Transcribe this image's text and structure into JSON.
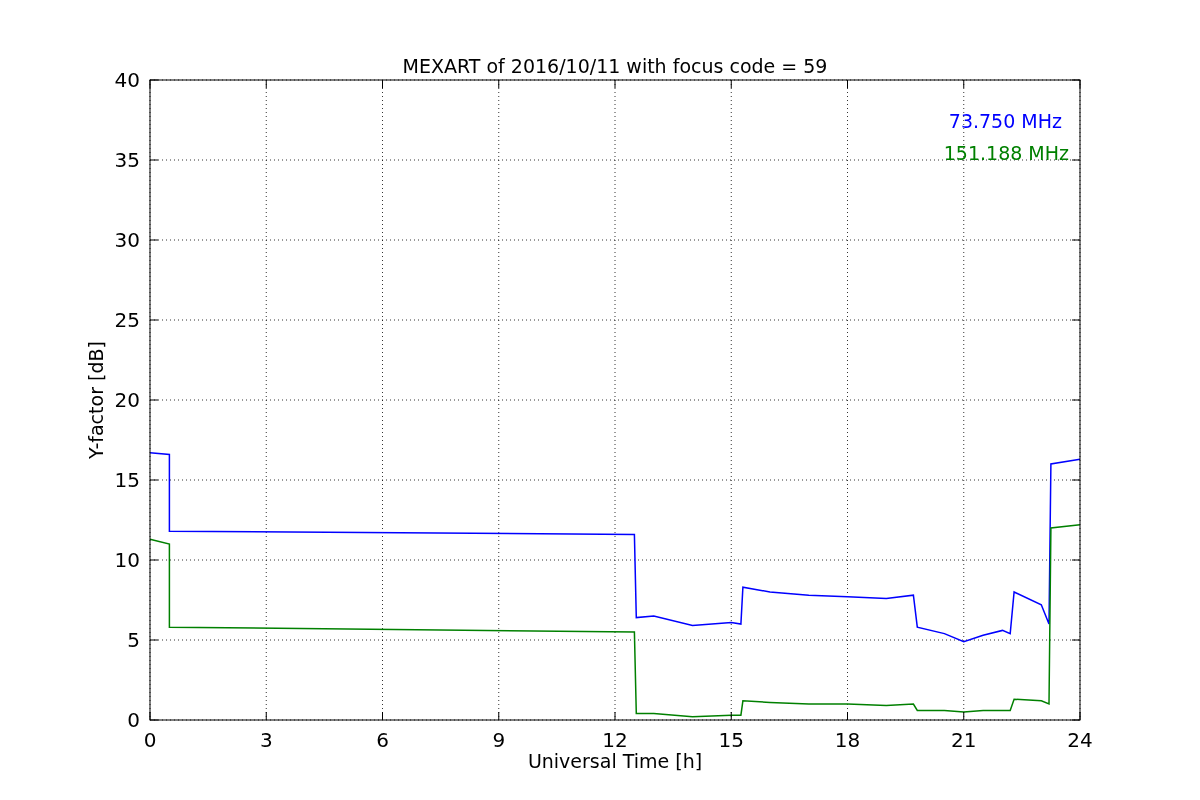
{
  "figure": {
    "chart_data": {
      "type": "line",
      "title": "MEXART of 2016/10/11 with focus code = 59",
      "xlabel": "Universal Time [h]",
      "ylabel": "Y-factor [dB]",
      "x": [
        0,
        0.5,
        0.5,
        12.5,
        12.55,
        13,
        14,
        15,
        15.25,
        15.3,
        16,
        17,
        18,
        19,
        19.7,
        19.8,
        20.5,
        21,
        21.5,
        22,
        22.2,
        22.3,
        23,
        23.2,
        23.25,
        24
      ],
      "series": [
        {
          "name": "73.750 MHz",
          "color": "#0000ff",
          "values": [
            16.7,
            16.6,
            11.8,
            11.6,
            6.4,
            6.5,
            5.9,
            6.1,
            6.0,
            8.3,
            8.0,
            7.8,
            7.7,
            7.6,
            7.8,
            5.8,
            5.4,
            4.9,
            5.3,
            5.6,
            5.4,
            8.0,
            7.2,
            6.0,
            16.0,
            16.3
          ]
        },
        {
          "name": "151.188 MHz",
          "color": "#008000",
          "values": [
            11.3,
            11.0,
            5.8,
            5.5,
            0.4,
            0.4,
            0.2,
            0.3,
            0.3,
            1.2,
            1.1,
            1.0,
            1.0,
            0.9,
            1.0,
            0.6,
            0.6,
            0.5,
            0.6,
            0.6,
            0.6,
            1.3,
            1.2,
            1.0,
            12.0,
            12.2
          ]
        }
      ],
      "grid": true,
      "xlim": [
        0,
        24
      ],
      "ylim": [
        0,
        40
      ],
      "xticks": [
        0,
        3,
        6,
        9,
        12,
        15,
        18,
        21,
        24
      ],
      "yticks": [
        0,
        5,
        10,
        15,
        20,
        25,
        30,
        35,
        40
      ]
    }
  }
}
